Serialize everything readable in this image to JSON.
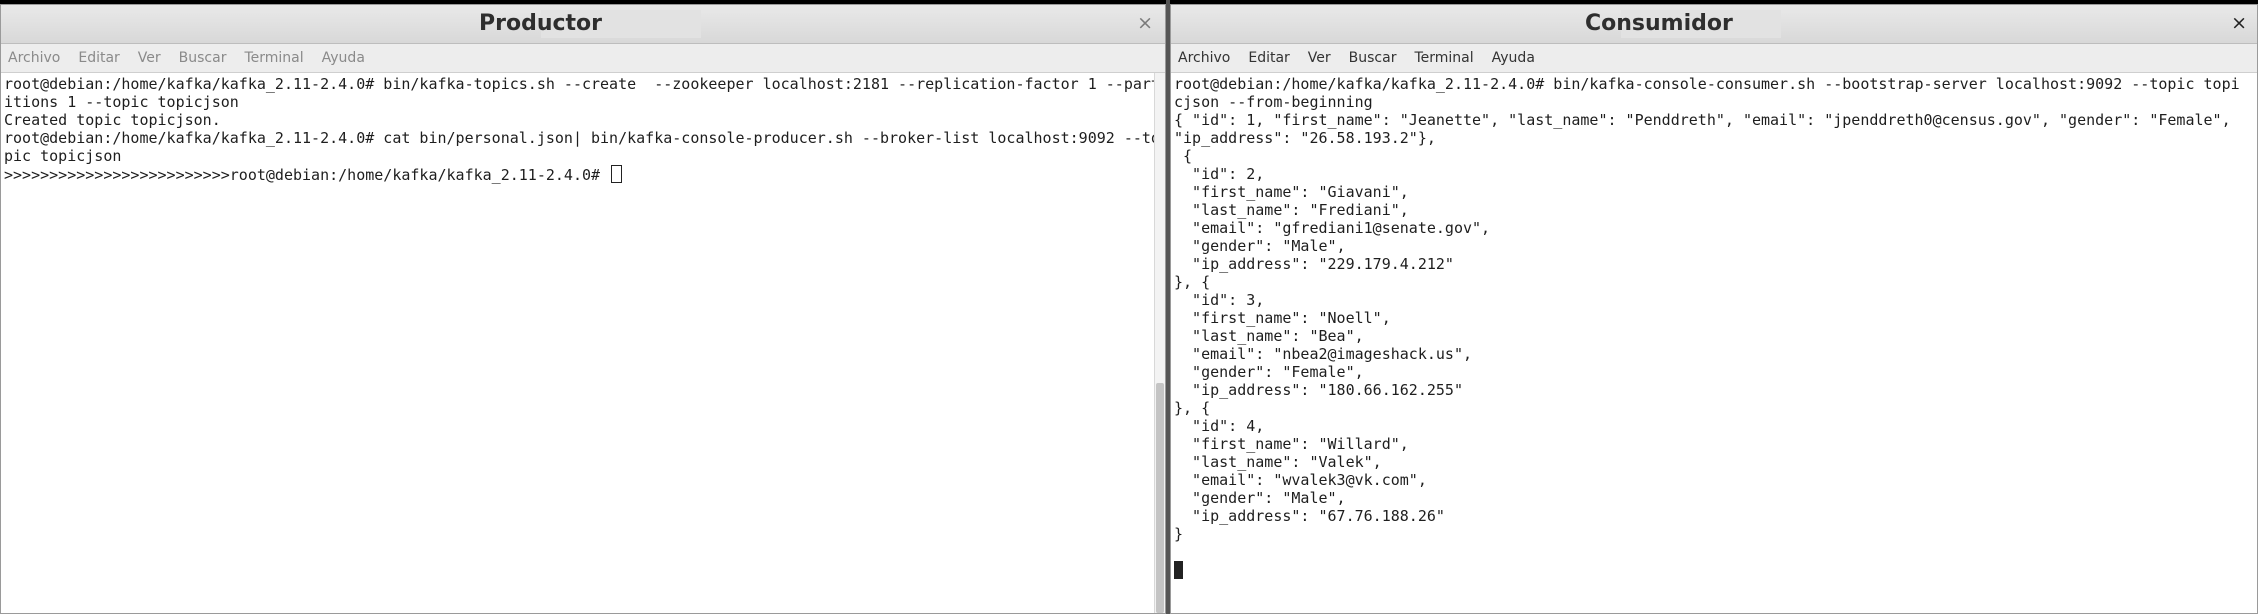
{
  "left_window": {
    "title": "Productor",
    "close_glyph": "×",
    "menu": [
      "Archivo",
      "Editar",
      "Ver",
      "Buscar",
      "Terminal",
      "Ayuda"
    ],
    "lines": [
      "root@debian:/home/kafka/kafka_2.11-2.4.0# bin/kafka-topics.sh --create  --zookeeper localhost:2181 --replication-factor 1 --part",
      "itions 1 --topic topicjson",
      "Created topic topicjson.",
      "root@debian:/home/kafka/kafka_2.11-2.4.0# cat bin/personal.json| bin/kafka-console-producer.sh --broker-list localhost:9092 --to",
      "pic topicjson",
      ">>>>>>>>>>>>>>>>>>>>>>>>>root@debian:/home/kafka/kafka_2.11-2.4.0# "
    ]
  },
  "right_window": {
    "title": "Consumidor",
    "close_glyph": "×",
    "menu": [
      "Archivo",
      "Editar",
      "Ver",
      "Buscar",
      "Terminal",
      "Ayuda"
    ],
    "lines": [
      "root@debian:/home/kafka/kafka_2.11-2.4.0# bin/kafka-console-consumer.sh --bootstrap-server localhost:9092 --topic topi",
      "cjson --from-beginning",
      "{ \"id\": 1, \"first_name\": \"Jeanette\", \"last_name\": \"Penddreth\", \"email\": \"jpenddreth0@census.gov\", \"gender\": \"Female\",",
      "\"ip_address\": \"26.58.193.2\"},",
      " {",
      "  \"id\": 2,",
      "  \"first_name\": \"Giavani\",",
      "  \"last_name\": \"Frediani\",",
      "  \"email\": \"gfrediani1@senate.gov\",",
      "  \"gender\": \"Male\",",
      "  \"ip_address\": \"229.179.4.212\"",
      "}, {",
      "  \"id\": 3,",
      "  \"first_name\": \"Noell\",",
      "  \"last_name\": \"Bea\",",
      "  \"email\": \"nbea2@imageshack.us\",",
      "  \"gender\": \"Female\",",
      "  \"ip_address\": \"180.66.162.255\"",
      "}, {",
      "  \"id\": 4,",
      "  \"first_name\": \"Willard\",",
      "  \"last_name\": \"Valek\",",
      "  \"email\": \"wvalek3@vk.com\",",
      "  \"gender\": \"Male\",",
      "  \"ip_address\": \"67.76.188.26\"",
      "}",
      ""
    ]
  }
}
